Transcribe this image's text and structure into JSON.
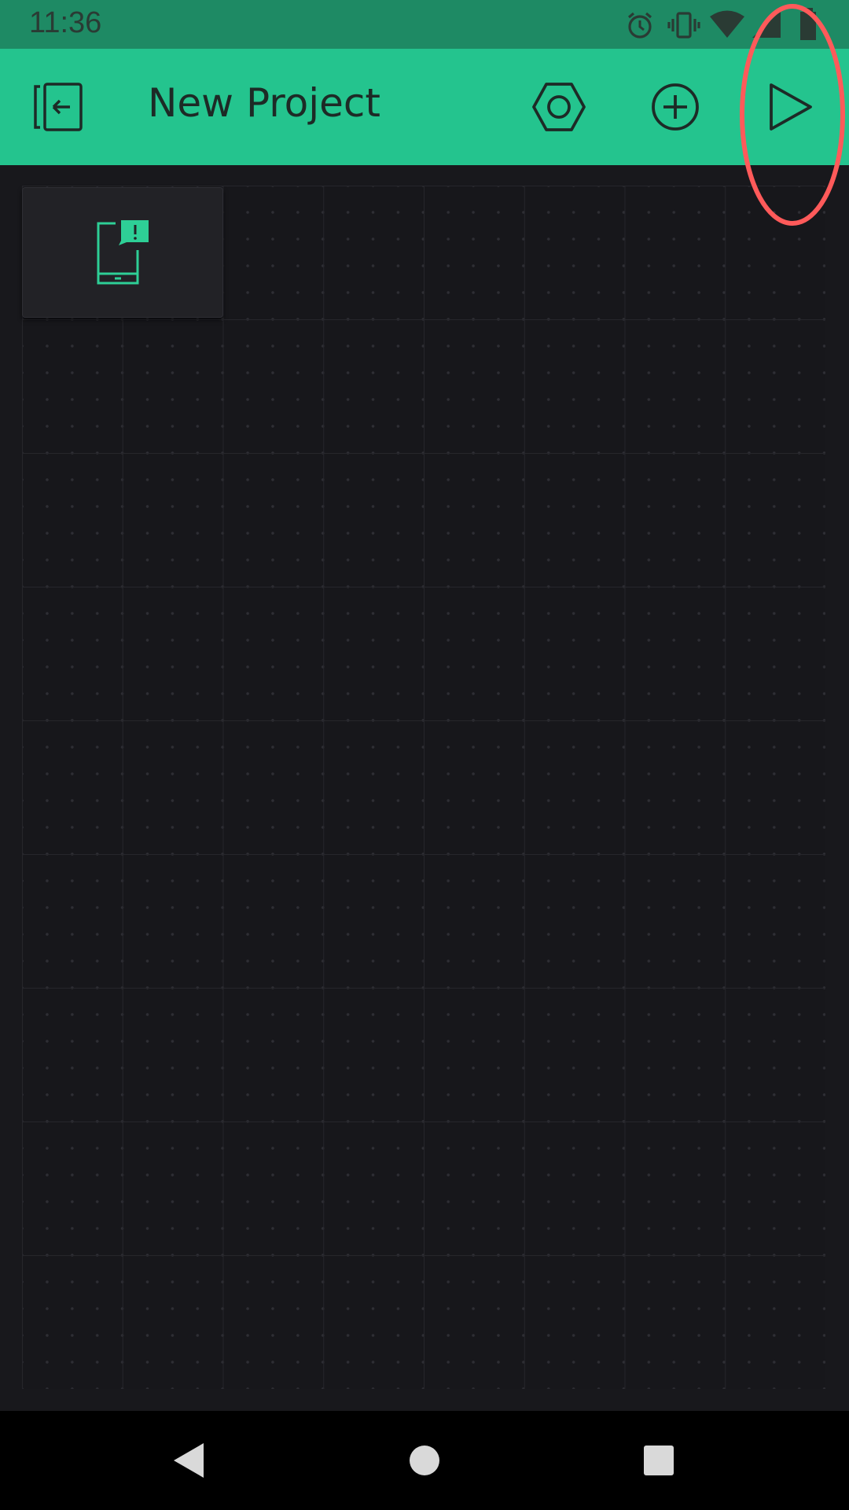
{
  "status_bar": {
    "time": "11:36",
    "icons": [
      "alarm-icon",
      "vibrate-icon",
      "wifi-icon",
      "signal-icon",
      "battery-icon"
    ]
  },
  "app_bar": {
    "title": "New Project",
    "actions": [
      "exit-icon",
      "settings-hexagon-icon",
      "add-widget-icon",
      "play-icon"
    ]
  },
  "canvas": {
    "widgets": [
      {
        "icon": "phone-notification-icon"
      }
    ]
  },
  "nav_bar": {
    "buttons": [
      "back-icon",
      "home-icon",
      "recents-icon"
    ]
  },
  "colors": {
    "status_bar": "#1e8a64",
    "app_bar": "#24c48e",
    "accent": "#2ecf96",
    "canvas": "#17171b",
    "annotation": "#ff5a5a"
  }
}
